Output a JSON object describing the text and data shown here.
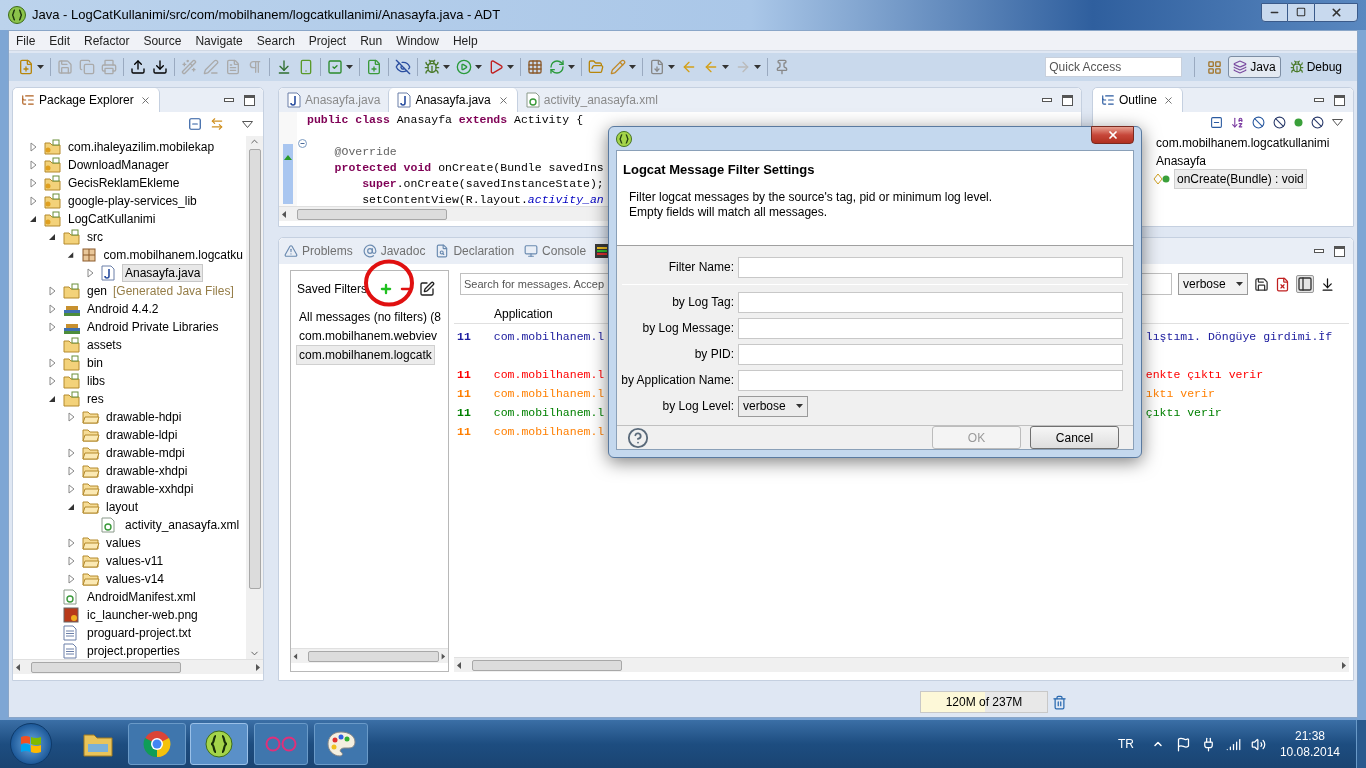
{
  "window": {
    "title": "Java - LogCatKullanimi/src/com/mobilhanem/logcatkullanimi/Anasayfa.java - ADT"
  },
  "menu": [
    "File",
    "Edit",
    "Refactor",
    "Source",
    "Navigate",
    "Search",
    "Project",
    "Run",
    "Window",
    "Help"
  ],
  "toolbar": {
    "quick_access": {
      "placeholder": "Quick Access"
    },
    "perspectives": [
      {
        "label": "Java",
        "selected": true
      },
      {
        "label": "Debug",
        "selected": false
      }
    ]
  },
  "package_explorer": {
    "title": "Package Explorer",
    "tree": [
      {
        "label": "com.ihaleyazilim.mobilekap",
        "kind": "project",
        "expanded": false,
        "selected": false
      },
      {
        "label": "DownloadManager",
        "kind": "project",
        "expanded": false,
        "selected": false
      },
      {
        "label": "GecisReklamEkleme",
        "kind": "project",
        "expanded": false,
        "selected": false
      },
      {
        "label": "google-play-services_lib",
        "kind": "project",
        "expanded": false,
        "selected": false
      },
      {
        "label": "LogCatKullanimi",
        "kind": "project",
        "expanded": true,
        "selected": false,
        "children": [
          {
            "label": "src",
            "kind": "source",
            "expanded": true,
            "selected": false,
            "children": [
              {
                "label": "com.mobilhanem.logcatku",
                "kind": "package",
                "expanded": true,
                "selected": false,
                "children": [
                  {
                    "label": "Anasayfa.java",
                    "kind": "java",
                    "expanded": false,
                    "selected": true
                  }
                ]
              }
            ]
          },
          {
            "label": "gen",
            "decoration": "[Generated Java Files]",
            "kind": "source",
            "expanded": false,
            "selected": false
          },
          {
            "label": "Android 4.4.2",
            "kind": "library",
            "expanded": false,
            "selected": false
          },
          {
            "label": "Android Private Libraries",
            "kind": "library",
            "expanded": false,
            "selected": false
          },
          {
            "label": "assets",
            "kind": "source",
            "selected": false
          },
          {
            "label": "bin",
            "kind": "source",
            "expanded": false,
            "selected": false
          },
          {
            "label": "libs",
            "kind": "source",
            "expanded": false,
            "selected": false
          },
          {
            "label": "res",
            "kind": "source",
            "expanded": true,
            "selected": false,
            "children": [
              {
                "label": "drawable-hdpi",
                "kind": "folder",
                "expanded": false,
                "selected": false
              },
              {
                "label": "drawable-ldpi",
                "kind": "folder",
                "selected": false
              },
              {
                "label": "drawable-mdpi",
                "kind": "folder",
                "expanded": false,
                "selected": false
              },
              {
                "label": "drawable-xhdpi",
                "kind": "folder",
                "expanded": false,
                "selected": false
              },
              {
                "label": "drawable-xxhdpi",
                "kind": "folder",
                "expanded": false,
                "selected": false
              },
              {
                "label": "layout",
                "kind": "folder",
                "expanded": true,
                "selected": false,
                "children": [
                  {
                    "label": "activity_anasayfa.xml",
                    "kind": "xml",
                    "selected": false
                  }
                ]
              },
              {
                "label": "values",
                "kind": "folder",
                "expanded": false,
                "selected": false
              },
              {
                "label": "values-v11",
                "kind": "folder",
                "expanded": false,
                "selected": false
              },
              {
                "label": "values-v14",
                "kind": "folder",
                "expanded": false,
                "selected": false
              }
            ]
          },
          {
            "label": "AndroidManifest.xml",
            "kind": "xml",
            "selected": false
          },
          {
            "label": "ic_launcher-web.png",
            "kind": "image",
            "selected": false
          },
          {
            "label": "proguard-project.txt",
            "kind": "text",
            "selected": false
          },
          {
            "label": "project.properties",
            "kind": "text",
            "selected": false
          }
        ]
      }
    ]
  },
  "editor": {
    "tabs": [
      {
        "label": "Anasayfa.java",
        "kind": "java",
        "selected": false
      },
      {
        "label": "Anasayfa.java",
        "kind": "java",
        "selected": true
      },
      {
        "label": "activity_anasayfa.xml",
        "kind": "xml",
        "selected": false
      }
    ],
    "lines": [
      {
        "kind": "code",
        "tokens": [
          {
            "text": "public class ",
            "kind": "keyword"
          },
          {
            "text": "Anasayfa ",
            "kind": "plain"
          },
          {
            "text": "extends ",
            "kind": "keyword"
          },
          {
            "text": "Activity {",
            "kind": "plain"
          }
        ]
      },
      {
        "kind": "blank"
      },
      {
        "kind": "code",
        "tokens": [
          {
            "text": "    @Override",
            "kind": "annotation"
          }
        ]
      },
      {
        "kind": "code",
        "tokens": [
          {
            "text": "    protected void ",
            "kind": "keyword"
          },
          {
            "text": "onCreate(Bundle savedIns",
            "kind": "plain"
          }
        ]
      },
      {
        "kind": "code",
        "tokens": [
          {
            "text": "        super",
            "kind": "keyword"
          },
          {
            "text": ".onCreate(savedInstanceState);",
            "kind": "plain"
          }
        ]
      },
      {
        "kind": "code",
        "tokens": [
          {
            "text": "        setContentView(R.layout.",
            "kind": "plain"
          },
          {
            "text": "activity_an",
            "kind": "field"
          }
        ]
      }
    ]
  },
  "outline": {
    "title": "Outline",
    "items": [
      {
        "label": "com.mobilhanem.logcatkullanimi",
        "kind": "package",
        "selected": false
      },
      {
        "label": "Anasayfa",
        "kind": "type",
        "selected": false
      },
      {
        "label": "onCreate(Bundle) : void",
        "kind": "method",
        "selected": true
      }
    ]
  },
  "logcat": {
    "tabs": [
      {
        "label": "Problems",
        "kind": "problems"
      },
      {
        "label": "Javadoc",
        "kind": "javadoc"
      },
      {
        "label": "Declaration",
        "kind": "declaration"
      },
      {
        "label": "Console",
        "kind": "console"
      }
    ],
    "saved_filters": {
      "title": "Saved Filters",
      "items": [
        {
          "label": "All messages (no filters) (8",
          "selected": false
        },
        {
          "label": "com.mobilhanem.webviev",
          "selected": false
        },
        {
          "label": "com.mobilhanem.logcatk",
          "selected": true
        }
      ]
    },
    "search": {
      "placeholder": "Search for messages. Accep"
    },
    "level_select": {
      "value": "verbose"
    },
    "columns": [
      "Application"
    ],
    "rows": [
      {
        "pid": "11",
        "application": "com.mobilhanem.l",
        "column_3": "lıştımı. Döngüye girdimi.İf",
        "color": "#2020a0",
        "wrapped": true
      },
      {
        "pid": "11",
        "application": "com.mobilhanem.l",
        "column_3": "enkte çıktı verir",
        "color": "#ff0000",
        "wrapped": false
      },
      {
        "pid": "11",
        "application": "com.mobilhanem.l",
        "column_3": "ıktı verir",
        "color": "#ff7f00",
        "wrapped": false
      },
      {
        "pid": "11",
        "application": "com.mobilhanem.l",
        "column_3": "çıktı verir",
        "color": "#008000",
        "wrapped": false
      },
      {
        "pid": "11",
        "application": "com.mobilhanem.l",
        "color": "#ff7f00",
        "wrapped": false
      }
    ]
  },
  "status_bar": {
    "memory": {
      "text": "120M of 237M",
      "level": 0.51
    }
  },
  "dialog": {
    "title": "Logcat Message Filter Settings",
    "description": [
      "Filter logcat messages by the source's tag, pid or minimum log level.",
      "Empty fields will match all messages."
    ],
    "name_field": {
      "label": "Filter Name:"
    },
    "fields": [
      {
        "label": "by Log Tag:",
        "kind": "text"
      },
      {
        "label": "by Log Message:",
        "kind": "text"
      },
      {
        "label": "by PID:",
        "kind": "text"
      },
      {
        "label": "by Application Name:",
        "kind": "text"
      },
      {
        "label": "by Log Level:",
        "kind": "select",
        "value": "verbose"
      }
    ],
    "buttons": [
      {
        "label": "OK",
        "disabled": true
      },
      {
        "label": "Cancel",
        "disabled": false
      }
    ]
  },
  "taskbar": {
    "language": "TR",
    "time": "21:38",
    "date": "10.08.2014"
  }
}
